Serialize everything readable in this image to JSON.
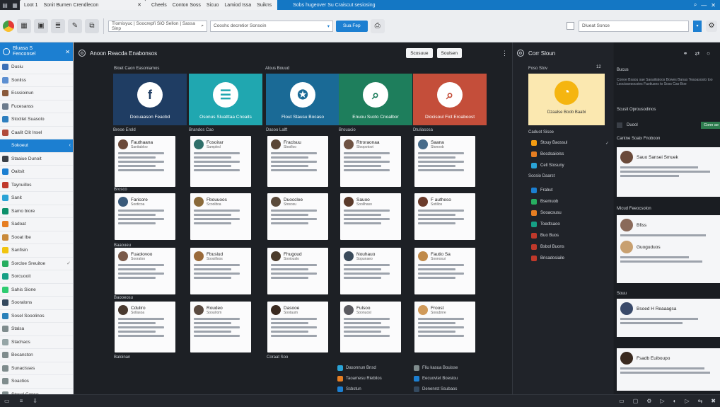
{
  "titlebar": {
    "tabs": [
      "Loot 1",
      "Sonit Bumen Crendlecon"
    ],
    "menu": [
      "Cheels",
      "Conton Soss",
      "Sicuo",
      "Lamiod Issa",
      "Suikns"
    ],
    "banner": "Sobs hugeover Su Craiscut sesiosing"
  },
  "toolbar": {
    "address": "Tlomisyuc | Soocrepfi SiO Sellon | Sassa Sinp",
    "dropdown": "Cooshc decretior Sonsoin",
    "go_button": "Sua Fep",
    "search_value": "Dlueat Sonce"
  },
  "sidebar": {
    "header_line1": "Bluasa S",
    "header_line2": "Fenconsel",
    "items": [
      {
        "label": "Dusiu",
        "color": "#3b6fb6"
      },
      {
        "label": "Sonliss",
        "color": "#5c8fd1"
      },
      {
        "label": "Esssioinun",
        "color": "#8a5a3c"
      },
      {
        "label": "Fucesanss",
        "color": "#6b7b8c"
      },
      {
        "label": "Stocllet Suasolo",
        "color": "#2e7fbf"
      },
      {
        "label": "Caalit Clit Insel",
        "color": "#b04a3a"
      },
      {
        "label": "Sokoeut",
        "color": "#1c7fd1"
      },
      {
        "label": "Staaiue Dunoit",
        "color": "#3a3f47"
      },
      {
        "label": "Oaitsit",
        "color": "#1c7fd1"
      },
      {
        "label": "Taynuillos",
        "color": "#c0392b"
      },
      {
        "label": "Sanit",
        "color": "#2aa3d6"
      },
      {
        "label": "Samo biore",
        "color": "#0b8f6a"
      },
      {
        "label": "Sadoat",
        "color": "#e67e22"
      },
      {
        "label": "Sooat Ibe",
        "color": "#c98a3a"
      },
      {
        "label": "Sanfisin",
        "color": "#f1c40f"
      },
      {
        "label": "Sorcloe Sreuitoe",
        "color": "#27ae60"
      },
      {
        "label": "Sorcuooit",
        "color": "#16a085"
      },
      {
        "label": "Sahis Sione",
        "color": "#2ecc71"
      },
      {
        "label": "Sooralons",
        "color": "#34495e"
      },
      {
        "label": "Sosel Sooolinos",
        "color": "#2980b9"
      },
      {
        "label": "Stalsa",
        "color": "#7f8c8d"
      },
      {
        "label": "Stachacs",
        "color": "#95a5a6"
      },
      {
        "label": "Becanston",
        "color": "#7f8c8d"
      },
      {
        "label": "Sunacisses",
        "color": "#7f8c8d"
      },
      {
        "label": "Soactios",
        "color": "#7f8c8d"
      },
      {
        "label": "Stesol Conso",
        "color": "#7f8c8d"
      }
    ]
  },
  "main": {
    "title": "Anoon Reacda Enabonsos",
    "btn1": "Scosuue",
    "btn2": "Soulsen",
    "col_label_1": "Bloet Caon Easoniamos",
    "col_label_2": "Alous Bouud",
    "tiles": [
      {
        "caption": "Docuaason Feacbd",
        "color": "#1f3d63",
        "icon": "f",
        "icon_color": "#1f3d63"
      },
      {
        "caption": "Osonus Sluatttaa Cnoaits",
        "color": "#20a7b0",
        "icon": "☰",
        "icon_color": "#20a7b0"
      },
      {
        "caption": "Flout Stausu Bocaso",
        "color": "#1a6a96",
        "icon": "✪",
        "icon_color": "#1a6a96"
      },
      {
        "caption": "Enuou Sucto Cnoalbor",
        "color": "#1e7e5c",
        "icon": "⌕",
        "icon_color": "#1e7e5c"
      },
      {
        "caption": "Dlocisoul Fict Eroaboost",
        "color": "#c44e3a",
        "icon": "⌕",
        "icon_color": "#c44e3a"
      }
    ],
    "col_heads": [
      "Breoe Erold",
      "Brandos Cao",
      "Dasoo Lalft",
      "Brouacio",
      "Dtuliasosa"
    ],
    "rows": [
      [
        {
          "name": "Fauthaana",
          "sub": "Sanitabloo",
          "av": "#6b4a3a"
        },
        {
          "name": "Fosoirar",
          "sub": "Sampled",
          "av": "#2f6f6a"
        },
        {
          "name": "Fraclsuu",
          "sub": "Stoolloo",
          "av": "#5a4636"
        },
        {
          "name": "Rtroraonaa",
          "sub": "Sloopotoot",
          "av": "#6f5343"
        },
        {
          "name": "Saana",
          "sub": "Stonoob",
          "av": "#476b8a"
        }
      ],
      [
        {
          "name": "Faricore",
          "sub": "Sooticoa",
          "av": "#3a5a7a"
        },
        {
          "name": "Fbouuoos",
          "sub": "Scoolitoa",
          "av": "#8a6a3a"
        },
        {
          "name": "Duocclee",
          "sub": "Stososu",
          "av": "#5a4a3a"
        },
        {
          "name": "Sauoo",
          "sub": "Soollhaso",
          "av": "#5a3a2a"
        },
        {
          "name": "F autheso",
          "sub": "Sotillos",
          "av": "#6a3a2a"
        }
      ],
      [
        {
          "name": "Fuaolovoo",
          "sub": "Sooraloo",
          "av": "#7a5a4a"
        },
        {
          "name": "Fbuslud",
          "sub": "Soosilloos",
          "av": "#9a6a3a"
        },
        {
          "name": "Fhugoud",
          "sub": "Sooiouslo",
          "av": "#4a3a2a"
        },
        {
          "name": "Nouhauo",
          "sub": "Sopunaeo",
          "av": "#3a4a5a"
        },
        {
          "name": "Fautio Sa",
          "sub": "Soonosui",
          "av": "#c08a4a"
        }
      ],
      [
        {
          "name": "Cduliro",
          "sub": "Sollasoa",
          "av": "#4a3a30"
        },
        {
          "name": "Roudeo",
          "sub": "Sooulrom",
          "av": "#5a4a40"
        },
        {
          "name": "Dasooe",
          "sub": "Sootaum",
          "av": "#3a2a20"
        },
        {
          "name": "Fulsoo",
          "sub": "Soonuosl",
          "av": "#5a5a60"
        },
        {
          "name": "Froost",
          "sub": "Sooubnre",
          "av": "#d09a5a"
        }
      ]
    ],
    "row_labels": [
      "Brosco",
      "Baaoueu",
      "Baooeosu"
    ],
    "footer_left": "Baloinan",
    "footer_mid": "Coraat Soo",
    "legend": [
      {
        "label": "Dasonnun Bnsd",
        "color": "#2aa3d6"
      },
      {
        "label": "Taoamesu Riebilos",
        "color": "#e67e22"
      },
      {
        "label": "Ssbstun",
        "color": "#1c7fd1"
      },
      {
        "label": "Fliu kasua Bouisse",
        "color": "#7f8c8d"
      },
      {
        "label": "Eecuovtet Boesiou",
        "color": "#1c7fd1"
      },
      {
        "label": "Denenrst Ssubaos",
        "color": "#34495e"
      }
    ]
  },
  "right": {
    "title": "Corr Sloun",
    "label": "Foso Stov",
    "num": "12",
    "tile_caption": "Dzaalse Boob Baabi",
    "sec1": "Caduot Sisoe",
    "sec2": "Scosio Daarst",
    "list1": [
      {
        "label": "Stouy Baossul",
        "color": "#f39c12"
      },
      {
        "label": "Bocdsaiiolss",
        "color": "#e67e22"
      },
      {
        "label": "Cell Stosuny",
        "color": "#2aa3d6"
      }
    ],
    "list2": [
      {
        "label": "Frabut",
        "color": "#1c7fd1"
      },
      {
        "label": "Bsemuob",
        "color": "#27ae60"
      },
      {
        "label": "Sooacsusu",
        "color": "#e67e22"
      },
      {
        "label": "Toedtsaoo",
        "color": "#16a085"
      },
      {
        "label": "Buo Buos",
        "color": "#c0392b"
      },
      {
        "label": "Bsbol Buons",
        "color": "#c0392b"
      },
      {
        "label": "Brisadosiaile",
        "color": "#c0392b"
      }
    ]
  },
  "far": {
    "head_icons": [
      "⚭",
      "⇄",
      "○"
    ],
    "lbl1": "Bucus",
    "text1": "Conoe Bsaou sae Saoaiilatoos Bowes Banas Teaoasosto too Lsoctssesocoies Faotiuses to Soss Cao Boe",
    "lbl2": "Scusit Oprousodinos",
    "opt_label": "Duool",
    "opt_pill": "Conn ae",
    "lbl3": "Cantne Soaix Fnoboon",
    "lbl4": "Micud Feeocsolon",
    "lbl5": "Souu",
    "cards": [
      {
        "name": "Sauo Sansei Smuek",
        "av": "#6a4a3a"
      },
      {
        "name": "Bfiss",
        "av": "#8a6a5a"
      },
      {
        "name": "Guoguduos",
        "av": "#c8a070"
      },
      {
        "name": "Bsoed H Reaaagsa",
        "av": "#3a4a6a"
      },
      {
        "name": "Fsadb Euiboupo",
        "av": "#3a2a20"
      }
    ]
  },
  "status": {
    "left_icons": [
      "▭",
      "≡",
      "⇩"
    ],
    "right_icons": [
      "▭",
      "▢",
      "⚙",
      "▷",
      "◐",
      "▷",
      "⇆",
      "✖"
    ]
  }
}
